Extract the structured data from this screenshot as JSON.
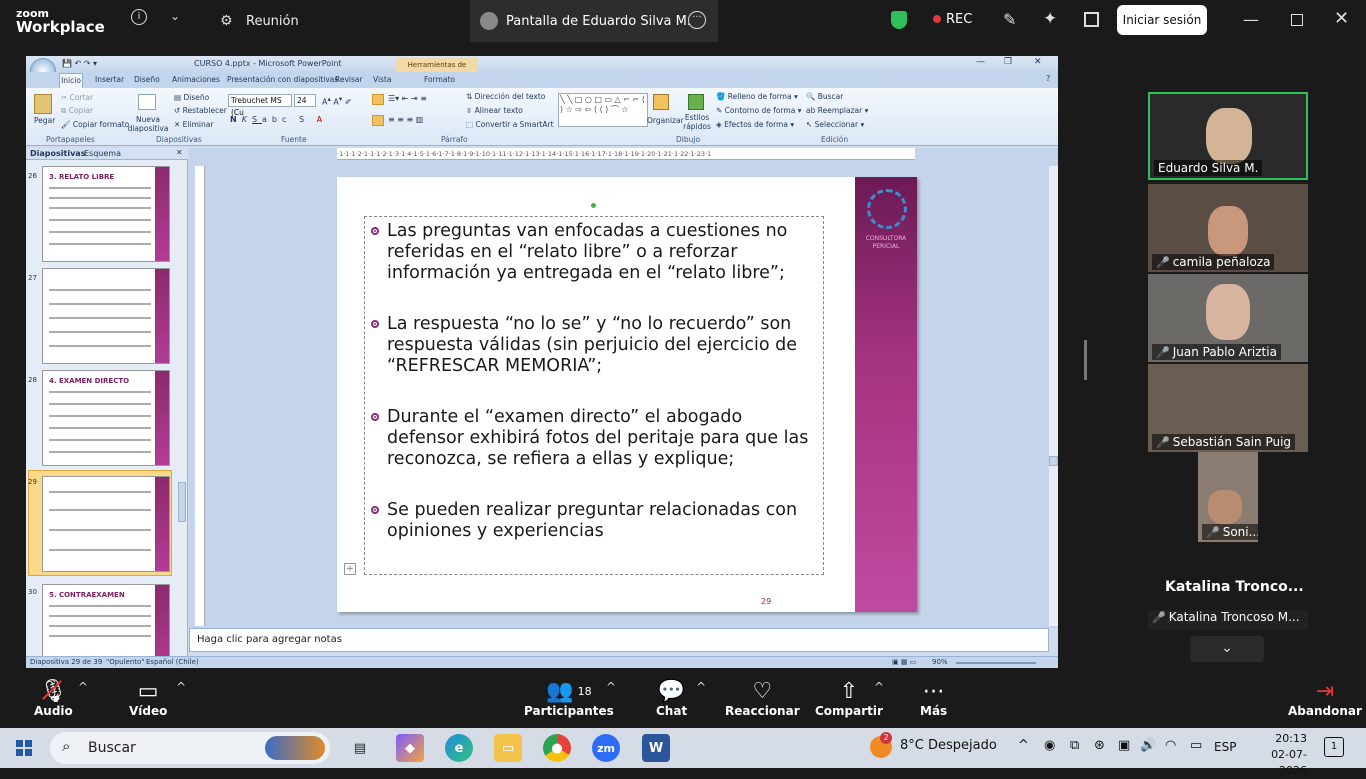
{
  "zoom": {
    "brand_line1": "zoom",
    "brand_line2": "Workplace",
    "meeting_label": "Reunión",
    "screen_share_title": "Pantalla de Eduardo Silva M.",
    "rec_label": "REC",
    "signin_label": "Iniciar sesión",
    "bottom": {
      "audio": "Audio",
      "video": "Vídeo",
      "participants": "Participantes",
      "participants_count": "18",
      "chat": "Chat",
      "reactions": "Reaccionar",
      "share": "Compartir",
      "more": "Más",
      "leave": "Abandonar"
    },
    "participants": [
      {
        "name": "Eduardo Silva M.",
        "muted": false
      },
      {
        "name": "camila peñaloza",
        "muted": true
      },
      {
        "name": "Juan Pablo Ariztia",
        "muted": true
      },
      {
        "name": "Sebastián Sain Puig",
        "muted": true
      },
      {
        "name": "Soni...",
        "muted": true
      }
    ],
    "big_name": "Katalina  Tronco...",
    "small_name": "Katalina Troncoso M..."
  },
  "ppt": {
    "title": "CURSO 4.pptx - Microsoft PowerPoint",
    "context_tab": "Herramientas de dibujo",
    "tabs": [
      "Inicio",
      "Insertar",
      "Diseño",
      "Animaciones",
      "Presentación con diapositivas",
      "Revisar",
      "Vista",
      "Formato"
    ],
    "clipboard": {
      "paste": "Pegar",
      "cut": "Cortar",
      "copy": "Copiar",
      "format_painter": "Copiar formato",
      "label": "Portapapeles"
    },
    "slides_group": {
      "new": "Nueva diapositiva",
      "layout": "Diseño",
      "reset": "Restablecer",
      "delete": "Eliminar",
      "label": "Diapositivas"
    },
    "font_group": {
      "font": "Trebuchet MS (Cu",
      "size": "24",
      "label": "Fuente"
    },
    "paragraph_group": {
      "text_direction": "Dirección del texto",
      "align_text": "Alinear texto",
      "smartart": "Convertir a SmartArt",
      "label": "Párrafo"
    },
    "drawing_group": {
      "arrange": "Organizar",
      "quick_styles": "Estilos rápidos",
      "fill": "Relleno de forma",
      "outline": "Contorno de forma",
      "effects": "Efectos de forma",
      "label": "Dibujo"
    },
    "edit_group": {
      "find": "Buscar",
      "replace": "Reemplazar",
      "select": "Seleccionar",
      "label": "Edición"
    },
    "panel_tabs": [
      "Diapositivas",
      "Esquema"
    ],
    "thumbs": [
      {
        "num": "26",
        "title": "3. RELATO LIBRE"
      },
      {
        "num": "27",
        "title": ""
      },
      {
        "num": "28",
        "title": "4. EXAMEN DIRECTO"
      },
      {
        "num": "29",
        "title": ""
      },
      {
        "num": "30",
        "title": "5. CONTRAEXAMEN"
      }
    ],
    "ruler": "·1·1·1·2·1·1·1·2·1·3·1·4·1·5·1·6·1·7·1·8·1·9·1·10·1·11·1·12·1·13·1·14·1·15·1·16·1·17·1·18·1·19·1·20·1·21·1·22·1·23·1",
    "slide": {
      "logo_text": "CONSULTORA PERICIAL",
      "page_num": "29",
      "bullets": [
        [
          "Las preguntas van enfocadas a cuestiones no",
          "referidas en el “relato libre” o a reforzar",
          "información ya entregada en el “relato libre”;"
        ],
        [
          "La respuesta “no lo se” y “no lo recuerdo” son",
          "respuesta válidas (sin perjuicio del ejercicio de",
          "“REFRESCAR MEMORIA”;"
        ],
        [
          "Durante el “examen directo” el abogado",
          "defensor exhibirá fotos del peritaje para que las",
          "reconozca, se refiera a ellas y explique;"
        ],
        [
          "Se pueden realizar preguntar relacionadas con",
          "opiniones y experiencias"
        ]
      ]
    },
    "notes": "Haga clic para agregar notas",
    "status": {
      "slide": "Diapositiva 29 de 39",
      "theme": "\"Opulento\"",
      "lang": "Español (Chile)",
      "zoom": "90%"
    }
  },
  "taskbar": {
    "search": "Buscar",
    "weather": "8°C  Despejado",
    "weather_badge": "2",
    "lang": "ESP",
    "time": "20:13",
    "date": "02-07-2026",
    "notif": "1"
  }
}
